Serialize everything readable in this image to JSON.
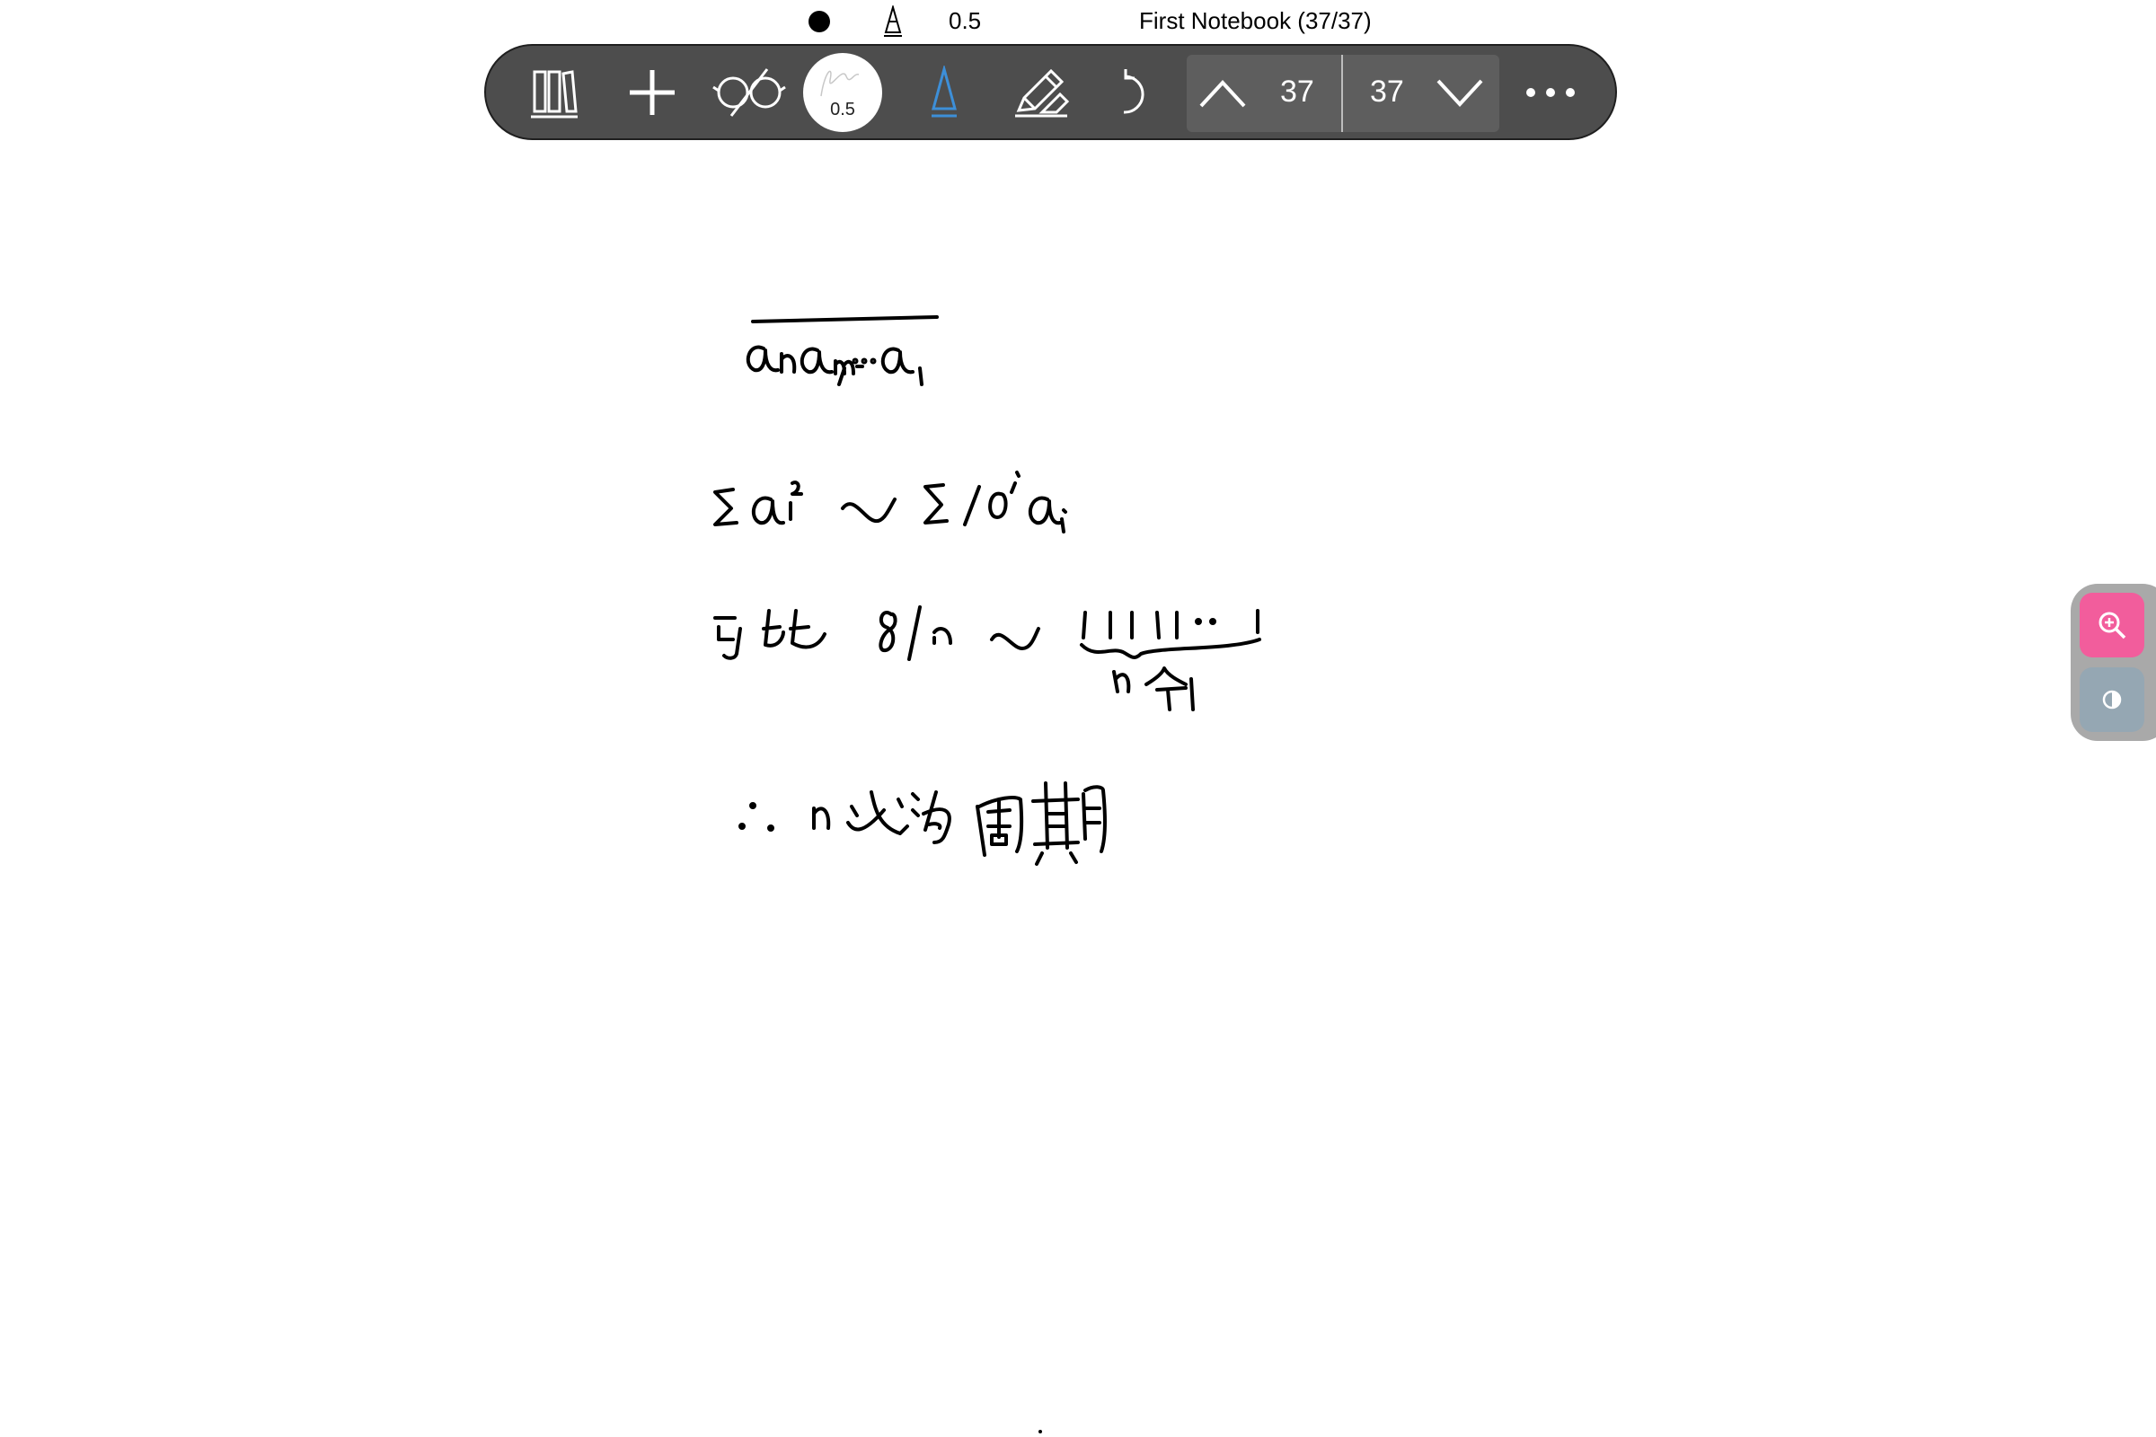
{
  "status_bar": {
    "pen_size": "0.5",
    "notebook_title": "First Notebook (37/37)"
  },
  "toolbar": {
    "pen_preview_size": "0.5",
    "current_page": "37",
    "total_pages": "37",
    "icons": [
      "library-icon",
      "add-icon",
      "reading-mode-icon",
      "pen-preview",
      "pen-tip-icon",
      "pencil-eraser-icon",
      "undo-icon",
      "page-up-icon",
      "page-down-icon",
      "more-icon"
    ],
    "accent_color": "#3d8fd8"
  },
  "canvas": {
    "handwriting_lines": [
      "a_n a_{n-1} … a_1 (overlined)",
      "Σ a_i² ~ Σ 10^i a_i",
      "可 tt 8|n ~ 11111…1 (n个1)",
      "∴ n 必为周期"
    ]
  },
  "side_panel": {
    "zoom_color": "#f25d9c",
    "contrast_color": "#95a7b3"
  }
}
